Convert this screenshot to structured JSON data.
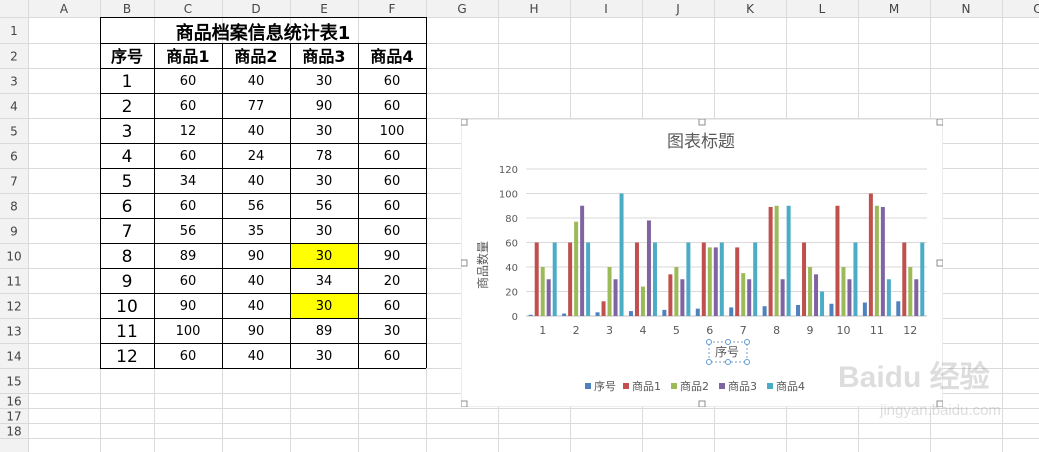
{
  "sheet": {
    "columns": [
      "A",
      "B",
      "C",
      "D",
      "E",
      "F",
      "G",
      "H",
      "I",
      "J",
      "K",
      "L",
      "M",
      "N",
      "O"
    ],
    "rows": [
      "1",
      "2",
      "3",
      "4",
      "5",
      "6",
      "7",
      "8",
      "9",
      "10",
      "11",
      "12",
      "13",
      "14",
      "15",
      "16",
      "17",
      "18"
    ]
  },
  "table": {
    "title": "商品档案信息统计表1",
    "headers": [
      "序号",
      "商品1",
      "商品2",
      "商品3",
      "商品4"
    ],
    "rows": [
      [
        "1",
        "60",
        "40",
        "30",
        "60"
      ],
      [
        "2",
        "60",
        "77",
        "90",
        "60"
      ],
      [
        "3",
        "12",
        "40",
        "30",
        "100"
      ],
      [
        "4",
        "60",
        "24",
        "78",
        "60"
      ],
      [
        "5",
        "34",
        "40",
        "30",
        "60"
      ],
      [
        "6",
        "60",
        "56",
        "56",
        "60"
      ],
      [
        "7",
        "56",
        "35",
        "30",
        "60"
      ],
      [
        "8",
        "89",
        "90",
        "30",
        "90"
      ],
      [
        "9",
        "60",
        "40",
        "34",
        "20"
      ],
      [
        "10",
        "90",
        "40",
        "30",
        "60"
      ],
      [
        "11",
        "100",
        "90",
        "89",
        "30"
      ],
      [
        "12",
        "60",
        "40",
        "30",
        "60"
      ]
    ],
    "highlight_color": "#ffff00",
    "highlighted_cells": [
      [
        7,
        3
      ],
      [
        9,
        3
      ]
    ]
  },
  "chart_data": {
    "type": "bar",
    "title": "图表标题",
    "xlabel": "序号",
    "ylabel": "商品数量",
    "categories": [
      "1",
      "2",
      "3",
      "4",
      "5",
      "6",
      "7",
      "8",
      "9",
      "10",
      "11",
      "12"
    ],
    "ylim": [
      0,
      120
    ],
    "yticks": [
      0,
      20,
      40,
      60,
      80,
      100,
      120
    ],
    "grid": true,
    "legend": "bottom",
    "series": [
      {
        "name": "序号",
        "color": "#4f81bd",
        "values": [
          1,
          2,
          3,
          4,
          5,
          6,
          7,
          8,
          9,
          10,
          11,
          12
        ]
      },
      {
        "name": "商品1",
        "color": "#c0504d",
        "values": [
          60,
          60,
          12,
          60,
          34,
          60,
          56,
          89,
          60,
          90,
          100,
          60
        ]
      },
      {
        "name": "商品2",
        "color": "#9bbb59",
        "values": [
          40,
          77,
          40,
          24,
          40,
          56,
          35,
          90,
          40,
          40,
          90,
          40
        ]
      },
      {
        "name": "商品3",
        "color": "#8064a2",
        "values": [
          30,
          90,
          30,
          78,
          30,
          56,
          30,
          30,
          34,
          30,
          89,
          30
        ]
      },
      {
        "name": "商品4",
        "color": "#4bacc6",
        "values": [
          60,
          60,
          100,
          60,
          60,
          60,
          60,
          90,
          20,
          60,
          30,
          60
        ]
      }
    ]
  },
  "watermark": {
    "brand": "Baidu 经验",
    "url": "jingyan.baidu.com"
  }
}
